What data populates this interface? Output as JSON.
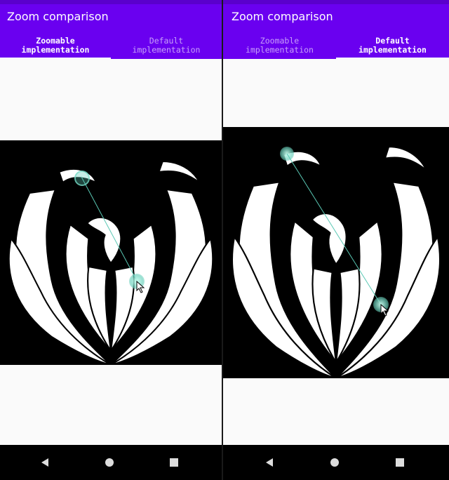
{
  "left": {
    "title": "Zoom comparison",
    "tabs": [
      {
        "label_line1": "Zoomable",
        "label_line2": "implementation",
        "active": true
      },
      {
        "label_line1": "Default",
        "label_line2": "implementation",
        "active": false
      }
    ]
  },
  "right": {
    "title": "Zoom comparison",
    "tabs": [
      {
        "label_line1": "Zoomable",
        "label_line2": "implementation",
        "active": false
      },
      {
        "label_line1": "Default",
        "label_line2": "implementation",
        "active": true
      }
    ]
  },
  "colors": {
    "app_bar": "#6a00f0",
    "touch": "#5ac8b4",
    "image_bg": "#000000",
    "image_fg": "#ffffff"
  },
  "icons": {
    "back": "back-triangle-icon",
    "home": "home-circle-icon",
    "recents": "recents-square-icon",
    "phoenix": "phoenix-emblem-image"
  }
}
